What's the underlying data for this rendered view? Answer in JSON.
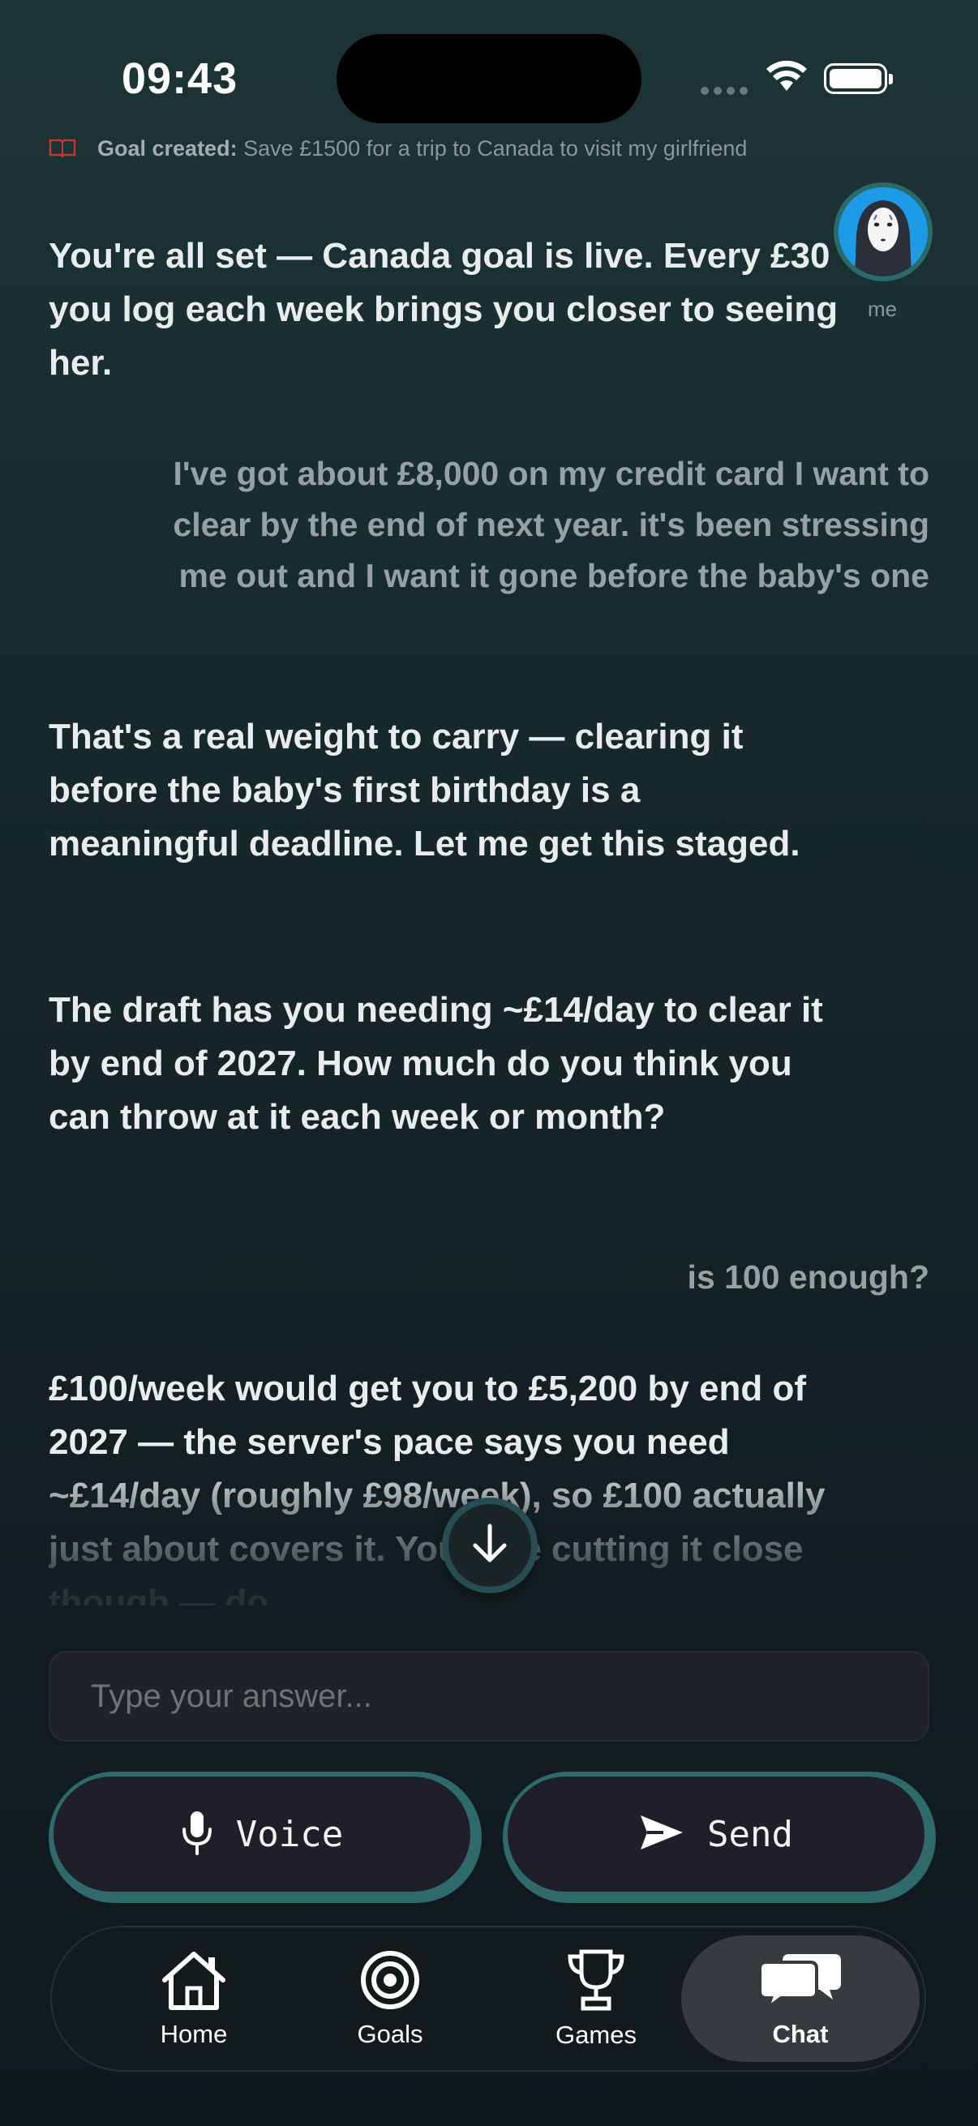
{
  "status_bar": {
    "time": "09:43"
  },
  "goal_banner": {
    "prefix": "Goal created:",
    "text": "Save £1500 for a trip to Canada to visit my girlfriend"
  },
  "avatar": {
    "label": "me"
  },
  "messages": [
    {
      "role": "assistant",
      "text": "You're all set — Canada goal is live. Every £30 you log each week brings you closer to seeing her."
    },
    {
      "role": "user",
      "text": "I've got about £8,000 on my credit card I want to clear by the end of next year. it's been stressing me out and I want it gone before the baby's one"
    },
    {
      "role": "assistant",
      "text": "That's a real weight to carry — clearing it before the baby's first birthday is a meaningful deadline. Let me get this staged."
    },
    {
      "role": "assistant",
      "text": "The draft has you needing ~£14/day to clear it by end of 2027. How much do you think you can throw at it each week or month?"
    },
    {
      "role": "user",
      "text": "is 100 enough?"
    },
    {
      "role": "assistant",
      "text": "£100/week would get you to £5,200 by end of 2027 — the server's pace says you need ~£14/day (roughly £98/week), so £100 actually just about covers it. You'd be cutting it close though — do"
    }
  ],
  "input": {
    "placeholder": "Type your answer..."
  },
  "buttons": {
    "voice": "Voice",
    "send": "Send"
  },
  "tabs": [
    {
      "label": "Home",
      "icon": "home-icon"
    },
    {
      "label": "Goals",
      "icon": "target-icon"
    },
    {
      "label": "Games",
      "icon": "trophy-icon"
    },
    {
      "label": "Chat",
      "icon": "chat-bubbles-icon",
      "active": true
    }
  ],
  "colors": {
    "background_top": "#1d3436",
    "background_bottom": "#0f181b",
    "button_ring": "#2e6a6a",
    "button_face": "#1e1f29",
    "active_tab": "#373b3d"
  }
}
